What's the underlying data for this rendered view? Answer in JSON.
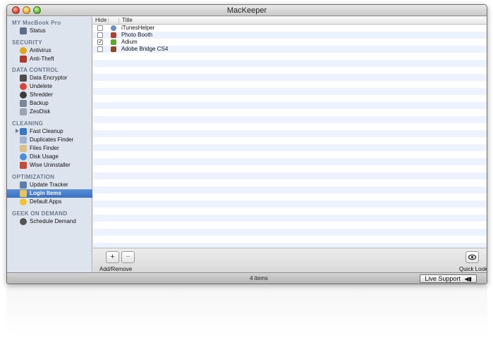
{
  "window": {
    "title": "MacKeeper"
  },
  "sidebar": {
    "sections": [
      {
        "header": "MY MacBook Pro",
        "items": [
          {
            "label": "Status",
            "icon": "monitor-icon",
            "color": "#5b6f8a"
          }
        ]
      },
      {
        "header": "SECURITY",
        "items": [
          {
            "label": "Antivirus",
            "icon": "biohazard-icon",
            "color": "#e2a51c"
          },
          {
            "label": "Anti-Theft",
            "icon": "thief-icon",
            "color": "#b0392b"
          }
        ]
      },
      {
        "header": "DATA CONTROL",
        "items": [
          {
            "label": "Data Encryptor",
            "icon": "encryptor-icon",
            "color": "#4d4d4d"
          },
          {
            "label": "Undelete",
            "icon": "lifebuoy-icon",
            "color": "#d8463a"
          },
          {
            "label": "Shredder",
            "icon": "shredder-icon",
            "color": "#3d3d3d"
          },
          {
            "label": "Backup",
            "icon": "backup-icon",
            "color": "#7c8796"
          },
          {
            "label": "ZeoDisk",
            "icon": "disk-icon",
            "color": "#9aa4b0"
          }
        ]
      },
      {
        "header": "CLEANING",
        "items": [
          {
            "label": "Fast Cleanup",
            "icon": "fast-cleanup-icon",
            "color": "#3a78c4"
          },
          {
            "label": "Duplicates Finder",
            "icon": "duplicates-icon",
            "color": "#9fb4d3"
          },
          {
            "label": "Files Finder",
            "icon": "files-icon",
            "color": "#d9c08a"
          },
          {
            "label": "Disk Usage",
            "icon": "pie-chart-icon",
            "color": "#4a8fd8"
          },
          {
            "label": "Wise Uninstaller",
            "icon": "uninstaller-icon",
            "color": "#c44a3a"
          }
        ]
      },
      {
        "header": "OPTIMIZATION",
        "items": [
          {
            "label": "Update Tracker",
            "icon": "update-icon",
            "color": "#5c7da8"
          },
          {
            "label": "Login Items",
            "icon": "login-items-icon",
            "color": "#e8c35a"
          },
          {
            "label": "Default Apps",
            "icon": "default-apps-icon",
            "color": "#f1c232"
          }
        ]
      },
      {
        "header": "GEEK ON DEMAND",
        "items": [
          {
            "label": "Schedule Demand",
            "icon": "schedule-icon",
            "color": "#555555"
          }
        ]
      }
    ],
    "selected": "Login Items"
  },
  "table": {
    "columns": {
      "hide": "Hide",
      "title": "Title"
    },
    "rows": [
      {
        "title": "iTunesHelper",
        "hidden": false,
        "icon": "itunes-helper-icon",
        "color": "#6d8fbf"
      },
      {
        "title": "Photo Booth",
        "hidden": false,
        "icon": "photo-booth-icon",
        "color": "#a8402f"
      },
      {
        "title": "Adium",
        "hidden": true,
        "icon": "adium-icon",
        "color": "#5fa82e"
      },
      {
        "title": "Adobe Bridge CS4",
        "hidden": false,
        "icon": "adobe-bridge-icon",
        "color": "#8a4a1e"
      }
    ]
  },
  "toolbar": {
    "add_symbol": "+",
    "remove_symbol": "−",
    "add_remove_label": "Add/Remove",
    "quick_look_label": "Quick Look",
    "quick_look_icon": "eye-icon"
  },
  "status": {
    "text": "4 items",
    "live_support": "Live Support"
  }
}
